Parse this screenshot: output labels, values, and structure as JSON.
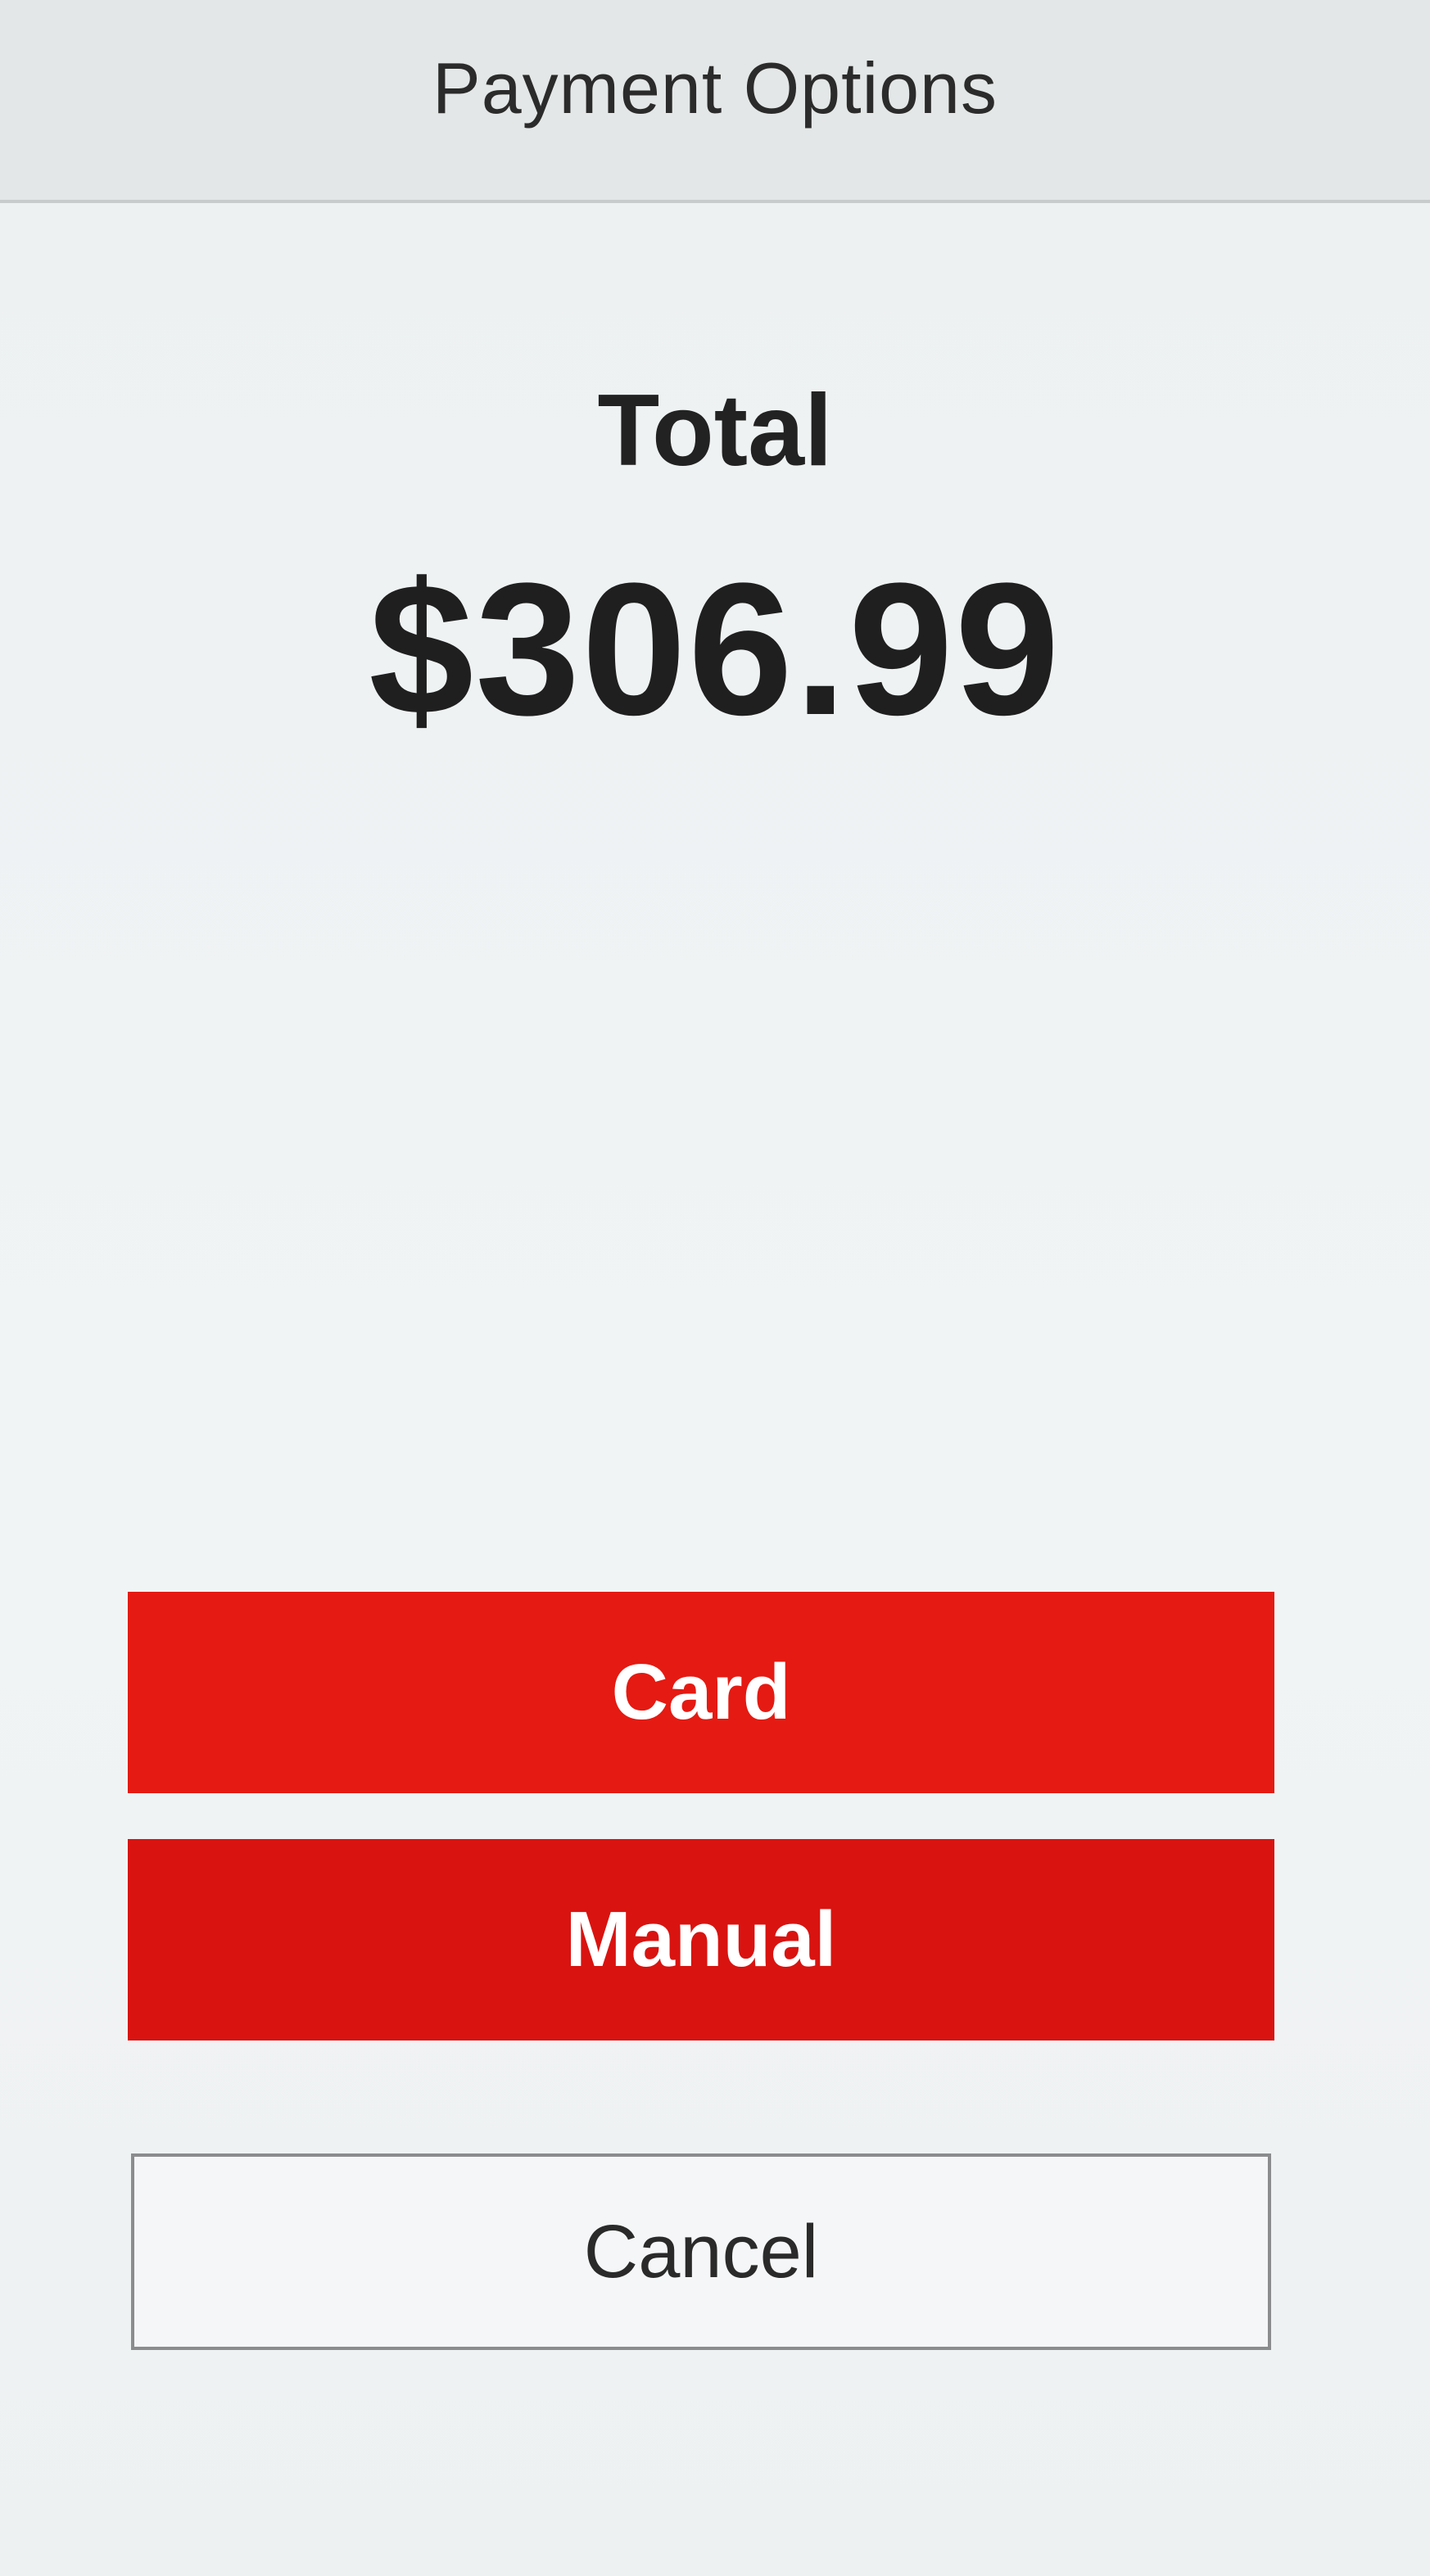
{
  "header": {
    "title": "Payment Options"
  },
  "total": {
    "label": "Total",
    "amount": "$306.99"
  },
  "actions": {
    "card_label": "Card",
    "manual_label": "Manual",
    "cancel_label": "Cancel"
  },
  "colors": {
    "accent_red": "#e51a12",
    "background": "#eef2f3",
    "header_background": "#e4e7e7"
  }
}
